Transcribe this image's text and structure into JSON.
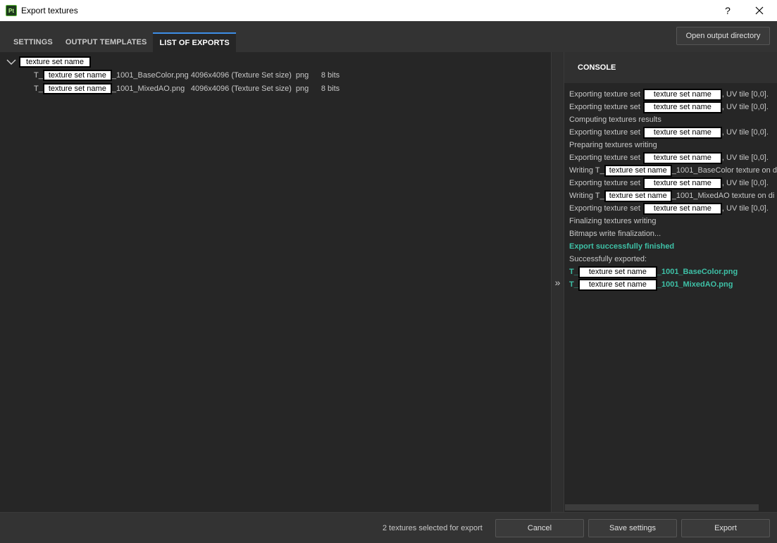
{
  "window": {
    "app_icon_text": "Pt",
    "title": "Export textures",
    "help_label": "?"
  },
  "tabs": [
    {
      "label": "SETTINGS"
    },
    {
      "label": "OUTPUT TEMPLATES"
    },
    {
      "label": "LIST OF EXPORTS"
    }
  ],
  "toolbar": {
    "open_output_dir_label": "Open output directory"
  },
  "export_list": {
    "texture_set": "texture set name",
    "files": [
      {
        "prefix": "T_",
        "set": "texture set name",
        "suffix": "_1001_BaseColor.png",
        "size": "4096x4096 (Texture Set size)",
        "format": "png",
        "depth": "8 bits"
      },
      {
        "prefix": "T_",
        "set": "texture set name",
        "suffix": "_1001_MixedAO.png",
        "size": "4096x4096 (Texture Set size)",
        "format": "png",
        "depth": "8 bits"
      }
    ]
  },
  "splitter": {
    "glyph": "»"
  },
  "console": {
    "title": "CONSOLE",
    "lines": [
      {
        "pre": "Exporting texture set",
        "name": "texture set name",
        "post": ", UV tile [0,0]."
      },
      {
        "pre": "Exporting texture set",
        "name": "texture set name",
        "post": ", UV tile [0,0]."
      },
      {
        "pre": "Computing textures results"
      },
      {
        "pre": "Exporting texture set",
        "name": "texture set name",
        "post": ", UV tile [0,0]."
      },
      {
        "pre": "Preparing textures writing"
      },
      {
        "pre": "Exporting texture set",
        "name": "texture set name",
        "post": ", UV tile [0,0]."
      },
      {
        "pre": "Writing T_",
        "name": "texture set name",
        "post": "_1001_BaseColor texture on d"
      },
      {
        "pre": "Exporting texture set",
        "name": "texture set name",
        "post": ", UV tile [0,0]."
      },
      {
        "pre": "Writing T_",
        "name": "texture set name",
        "post": "_1001_MixedAO texture on di"
      },
      {
        "pre": "Exporting texture set",
        "name": "texture set name",
        "post": ", UV tile [0,0]."
      },
      {
        "pre": "Finalizing textures writing"
      },
      {
        "pre": "Bitmaps write finalization..."
      },
      {
        "pre": "Export successfully finished",
        "success": true
      },
      {
        "pre": "Successfully exported:"
      },
      {
        "pre": "T_",
        "name": "texture set name",
        "post": "_1001_BaseColor.png",
        "success": true
      },
      {
        "pre": "T_",
        "name": "texture set name",
        "post": "_1001_MixedAO.png",
        "success": true
      }
    ],
    "success_color": "#3ec0a6"
  },
  "footer": {
    "status": "2 textures selected for export",
    "cancel_label": "Cancel",
    "save_settings_label": "Save settings",
    "export_label": "Export"
  },
  "colors": {
    "accent": "#3d8ee6",
    "panel_bg": "#262626"
  }
}
